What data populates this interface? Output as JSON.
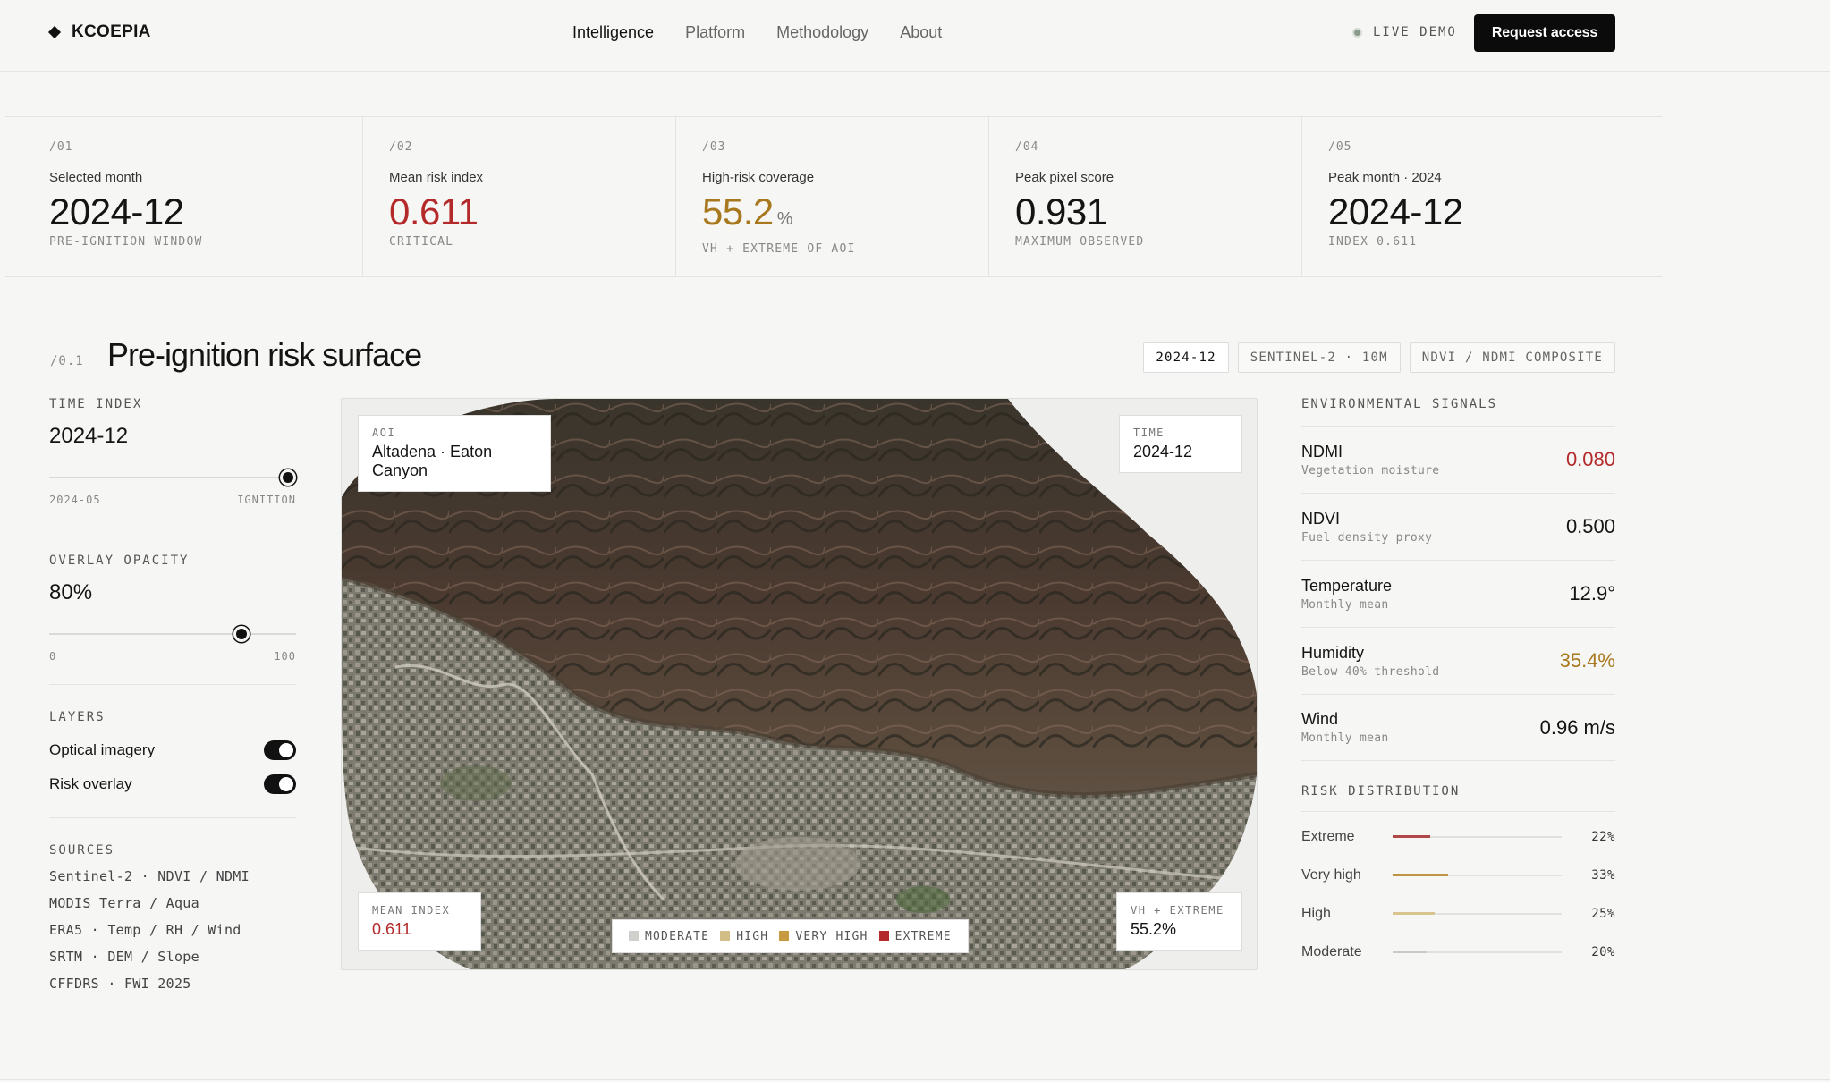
{
  "brand": {
    "name": "KCOEPIA"
  },
  "nav": {
    "items": [
      "Intelligence",
      "Platform",
      "Methodology",
      "About"
    ]
  },
  "header": {
    "live_label": "LIVE DEMO",
    "cta_label": "Request access"
  },
  "kpis": [
    {
      "idx": "/01",
      "label": "Selected month",
      "value": "2024-12",
      "unit": "",
      "sub": "PRE-IGNITION WINDOW",
      "color": "#141414"
    },
    {
      "idx": "/02",
      "label": "Mean risk index",
      "value": "0.611",
      "unit": "",
      "sub": "CRITICAL",
      "color": "#b42a2a"
    },
    {
      "idx": "/03",
      "label": "High-risk coverage",
      "value": "55.2",
      "unit": "%",
      "sub": "VH + EXTREME OF AOI",
      "color": "#a8781e"
    },
    {
      "idx": "/04",
      "label": "Peak pixel score",
      "value": "0.931",
      "unit": "",
      "sub": "MAXIMUM OBSERVED",
      "color": "#141414"
    },
    {
      "idx": "/05",
      "label": "Peak month · 2024",
      "value": "2024-12",
      "unit": "",
      "sub": "INDEX 0.611",
      "color": "#141414"
    }
  ],
  "section": {
    "idx": "/0.1",
    "title": "Pre-ignition risk surface",
    "chips": [
      "2024-12",
      "SENTINEL-2 · 10M",
      "NDVI / NDMI COMPOSITE"
    ]
  },
  "controls": {
    "time_label": "TIME INDEX",
    "time_value": "2024-12",
    "time_min": "2024-05",
    "time_max": "IGNITION",
    "time_level": 1.0,
    "opacity_label": "OVERLAY OPACITY",
    "opacity_value": "80%",
    "opacity_min": "0",
    "opacity_max": "100",
    "opacity_level": 0.8,
    "layers_label": "LAYERS",
    "layers": [
      {
        "label": "Optical imagery",
        "on": true
      },
      {
        "label": "Risk overlay",
        "on": true
      }
    ],
    "sources_label": "SOURCES",
    "sources": [
      "Sentinel-2 · NDVI / NDMI",
      "MODIS Terra / Aqua",
      "ERA5 · Temp / RH / Wind",
      "SRTM · DEM / Slope",
      "CFFDRS · FWI 2025"
    ]
  },
  "map": {
    "aoi_label": "AOI",
    "aoi_value": "Altadena · Eaton Canyon",
    "time_label": "TIME",
    "time_value": "2024-12",
    "mean_label": "MEAN INDEX",
    "mean_value": "0.611",
    "vh_label": "VH + EXTREME",
    "vh_value": "55.2%",
    "legend": [
      {
        "label": "MODERATE",
        "color": "#cfcfcc"
      },
      {
        "label": "HIGH",
        "color": "#d3bd86"
      },
      {
        "label": "VERY HIGH",
        "color": "#c99a3f"
      },
      {
        "label": "EXTREME",
        "color": "#b42a2a"
      }
    ]
  },
  "signals": {
    "label": "ENVIRONMENTAL SIGNALS",
    "items": [
      {
        "name": "NDMI",
        "desc": "Vegetation moisture",
        "value": "0.080",
        "color": "#b42a2a"
      },
      {
        "name": "NDVI",
        "desc": "Fuel density proxy",
        "value": "0.500",
        "color": "#141414"
      },
      {
        "name": "Temperature",
        "desc": "Monthly mean",
        "value": "12.9°",
        "color": "#141414"
      },
      {
        "name": "Humidity",
        "desc": "Below 40% threshold",
        "value": "35.4%",
        "color": "#a8781e"
      },
      {
        "name": "Wind",
        "desc": "Monthly mean",
        "value": "0.96 m/s",
        "color": "#141414"
      }
    ]
  },
  "distribution": {
    "label": "RISK DISTRIBUTION",
    "items": [
      {
        "name": "Extreme",
        "pct": "22%",
        "level": 0.22,
        "color": "#b04848"
      },
      {
        "name": "Very high",
        "pct": "33%",
        "level": 0.33,
        "color": "#bf9444"
      },
      {
        "name": "High",
        "pct": "25%",
        "level": 0.25,
        "color": "#d7c48f"
      },
      {
        "name": "Moderate",
        "pct": "20%",
        "level": 0.2,
        "color": "#c9c9c6"
      }
    ]
  }
}
